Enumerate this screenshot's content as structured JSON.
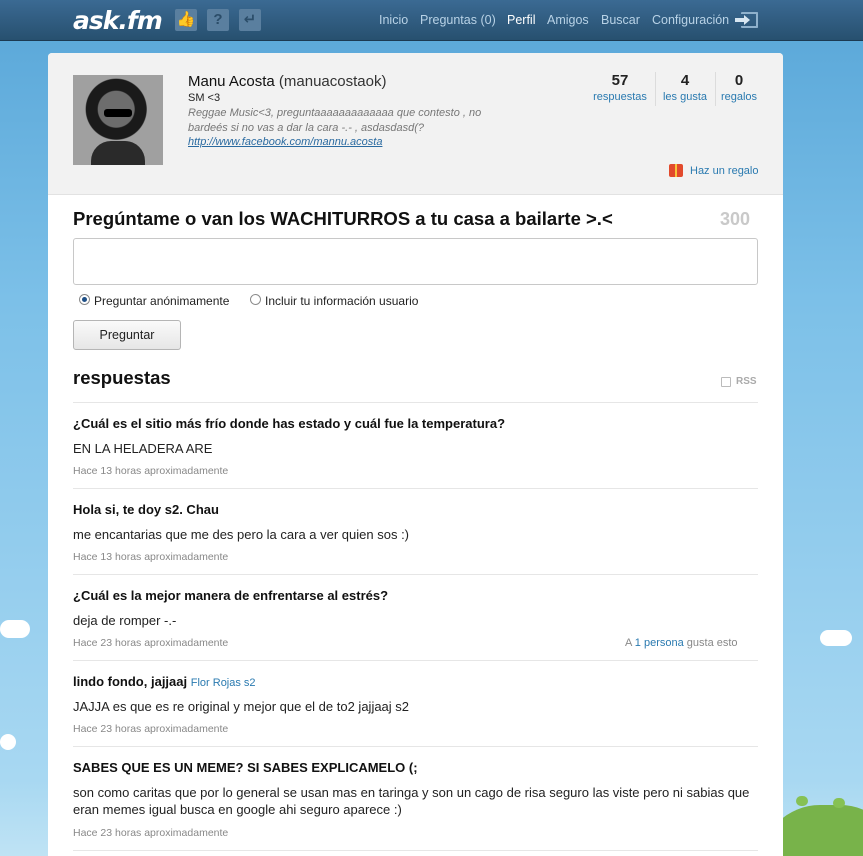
{
  "topbar": {
    "logo_main": "ask",
    "logo_dot_fm": ".fm",
    "nav": [
      "Inicio",
      "Preguntas (0)",
      "Perfil",
      "Amigos",
      "Buscar",
      "Configuración"
    ],
    "active": "Perfil",
    "icons": [
      "like-icon",
      "question-icon",
      "reply-icon",
      "logout-icon"
    ]
  },
  "profile": {
    "name": "Manu Acosta",
    "username": "(manuacostaok)",
    "status": "SM <3",
    "bio": "Reggae Music<3, preguntaaaaaaaaaaaaa que contesto , no bardeés si no vas a dar la cara -.- , asdasdasd(?",
    "link": "http://www.facebook.com/mannu.acosta",
    "stats": [
      {
        "num": "57",
        "label": "respuestas"
      },
      {
        "num": "4",
        "label": "les gusta"
      },
      {
        "num": "0",
        "label": "regalos"
      }
    ],
    "gift_label": "Haz un regalo"
  },
  "ask": {
    "title": "Pregúntame o van los WACHITURROS a tu casa a bailarte >.<",
    "char_count": "300",
    "input_value": "",
    "radio_anonymous": "Preguntar anónimamente",
    "radio_user": "Incluir tu información usuario",
    "button": "Preguntar"
  },
  "answers_section": {
    "title": "respuestas",
    "rss": "RSS",
    "items": [
      {
        "question": "¿Cuál es el sitio más frío donde has estado y cuál fue la temperatura?",
        "asker": "",
        "answer": "EN LA HELADERA ARE",
        "time": "Hace 13 horas aproximadamente",
        "likes_prefix": "",
        "likes_link": "",
        "likes_suffix": ""
      },
      {
        "question": "Hola si, te doy s2. Chau",
        "asker": "",
        "answer": "me encantarias que me des pero la cara a ver quien sos :)",
        "time": "Hace 13 horas aproximadamente",
        "likes_prefix": "",
        "likes_link": "",
        "likes_suffix": ""
      },
      {
        "question": "¿Cuál es la mejor manera de enfrentarse al estrés?",
        "asker": "",
        "answer": "deja de romper -.-",
        "time": "Hace 23 horas aproximadamente",
        "likes_prefix": "A",
        "likes_link": "1 persona",
        "likes_suffix": "gusta esto"
      },
      {
        "question": "lindo fondo, jajjaaj",
        "asker": "Flor Rojas s2",
        "answer": "JAJJA es que es re original y mejor que el de to2 jajjaaj s2",
        "time": "Hace 23 horas aproximadamente",
        "likes_prefix": "",
        "likes_link": "",
        "likes_suffix": ""
      },
      {
        "question": "SABES QUE ES UN MEME? SI SABES EXPLICAMELO (;",
        "asker": "",
        "answer": "son como caritas que por lo general se usan mas en taringa y son un cago de risa seguro las viste pero ni sabias que eran memes igual busca en google ahi seguro aparece :)",
        "time": "Hace 23 horas aproximadamente",
        "likes_prefix": "",
        "likes_link": "",
        "likes_suffix": ""
      }
    ]
  }
}
